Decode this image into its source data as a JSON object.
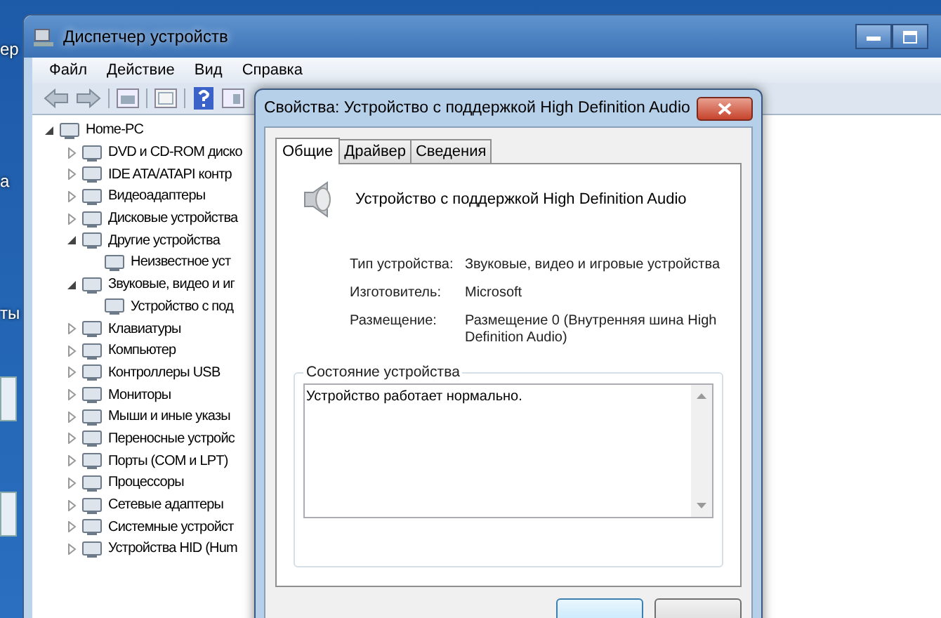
{
  "desktop": {
    "labels": [
      "ер",
      "а",
      "ты"
    ]
  },
  "window": {
    "title": "Диспетчер устройств"
  },
  "menu": [
    "Файл",
    "Действие",
    "Вид",
    "Справка"
  ],
  "tree": [
    {
      "label": "Home-PC",
      "expanded": true,
      "children": [
        {
          "label": "DVD и CD-ROM диско",
          "expanded": false
        },
        {
          "label": "IDE ATA/ATAPI контр",
          "expanded": false
        },
        {
          "label": "Видеоадаптеры",
          "expanded": false
        },
        {
          "label": "Дисковые устройства",
          "expanded": false
        },
        {
          "label": "Другие устройства",
          "expanded": true,
          "children": [
            {
              "label": "Неизвестное уст"
            }
          ]
        },
        {
          "label": "Звуковые, видео и иг",
          "expanded": true,
          "children": [
            {
              "label": "Устройство с под"
            }
          ]
        },
        {
          "label": "Клавиатуры",
          "expanded": false
        },
        {
          "label": "Компьютер",
          "expanded": false
        },
        {
          "label": "Контроллеры USB",
          "expanded": false
        },
        {
          "label": "Мониторы",
          "expanded": false
        },
        {
          "label": "Мыши и иные указы",
          "expanded": false
        },
        {
          "label": "Переносные устройс",
          "expanded": false
        },
        {
          "label": "Порты (COM и LPT)",
          "expanded": false
        },
        {
          "label": "Процессоры",
          "expanded": false
        },
        {
          "label": "Сетевые адаптеры",
          "expanded": false
        },
        {
          "label": "Системные устройст",
          "expanded": false
        },
        {
          "label": "Устройства HID (Hum",
          "expanded": false
        }
      ]
    }
  ],
  "dialog": {
    "title": "Свойства: Устройство с поддержкой High Definition Audio",
    "tabs": [
      {
        "label": "Общие",
        "selected": true
      },
      {
        "label": "Драйвер",
        "selected": false
      },
      {
        "label": "Сведения",
        "selected": false
      }
    ],
    "device_name": "Устройство с поддержкой High Definition Audio",
    "properties": [
      {
        "label": "Тип устройства:",
        "value": "Звуковые, видео и игровые устройства"
      },
      {
        "label": "Изготовитель:",
        "value": "Microsoft"
      },
      {
        "label": "Размещение:",
        "value": "Размещение 0 (Внутренняя шина High Definition Audio)"
      }
    ],
    "status_group": {
      "title": "Состояние устройства",
      "text": "Устройство работает нормально."
    }
  }
}
